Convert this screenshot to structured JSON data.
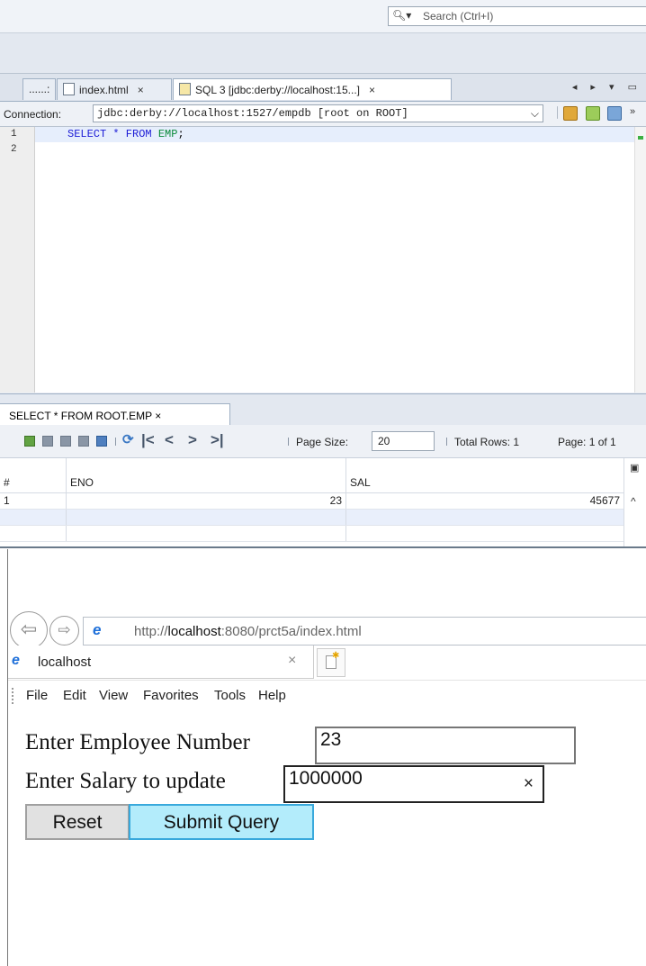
{
  "ide": {
    "search_placeholder": "Search (Ctrl+I)",
    "tabs": [
      {
        "label": "......:"
      },
      {
        "label": "index.html",
        "close": "×"
      },
      {
        "label": "SQL 3 [jdbc:derby://localhost:15...]",
        "close": "×"
      }
    ],
    "connection_label": "Connection:",
    "connection_value": "jdbc:derby://localhost:1527/empdb [root on ROOT]",
    "line_numbers": [
      "1",
      "2"
    ],
    "sql": {
      "kw1": "SELECT * FROM ",
      "table": "EMP",
      "end": ";"
    },
    "result_tab": "SELECT * FROM ROOT.EMP ×",
    "page_size_label": "Page Size:",
    "page_size_value": "20",
    "total_rows": "Total Rows: 1",
    "page_of": "Page: 1 of 1",
    "grid": {
      "headers": [
        "#",
        "ENO",
        "SAL"
      ],
      "rows": [
        [
          "1",
          "23",
          "45677"
        ]
      ]
    }
  },
  "browser": {
    "url_prefix": "http://",
    "url_host": "localhost",
    "url_rest": ":8080/prct5a/index.html",
    "tab_title": "localhost",
    "tab_close": "×",
    "menu": [
      "File",
      "Edit",
      "View",
      "Favorites",
      "Tools",
      "Help"
    ],
    "form": {
      "emp_label": "Enter Employee Number",
      "emp_value": "23",
      "sal_label": "Enter Salary to update",
      "sal_value": "1000000",
      "clear": "×",
      "reset": "Reset",
      "submit": "Submit Query"
    }
  }
}
